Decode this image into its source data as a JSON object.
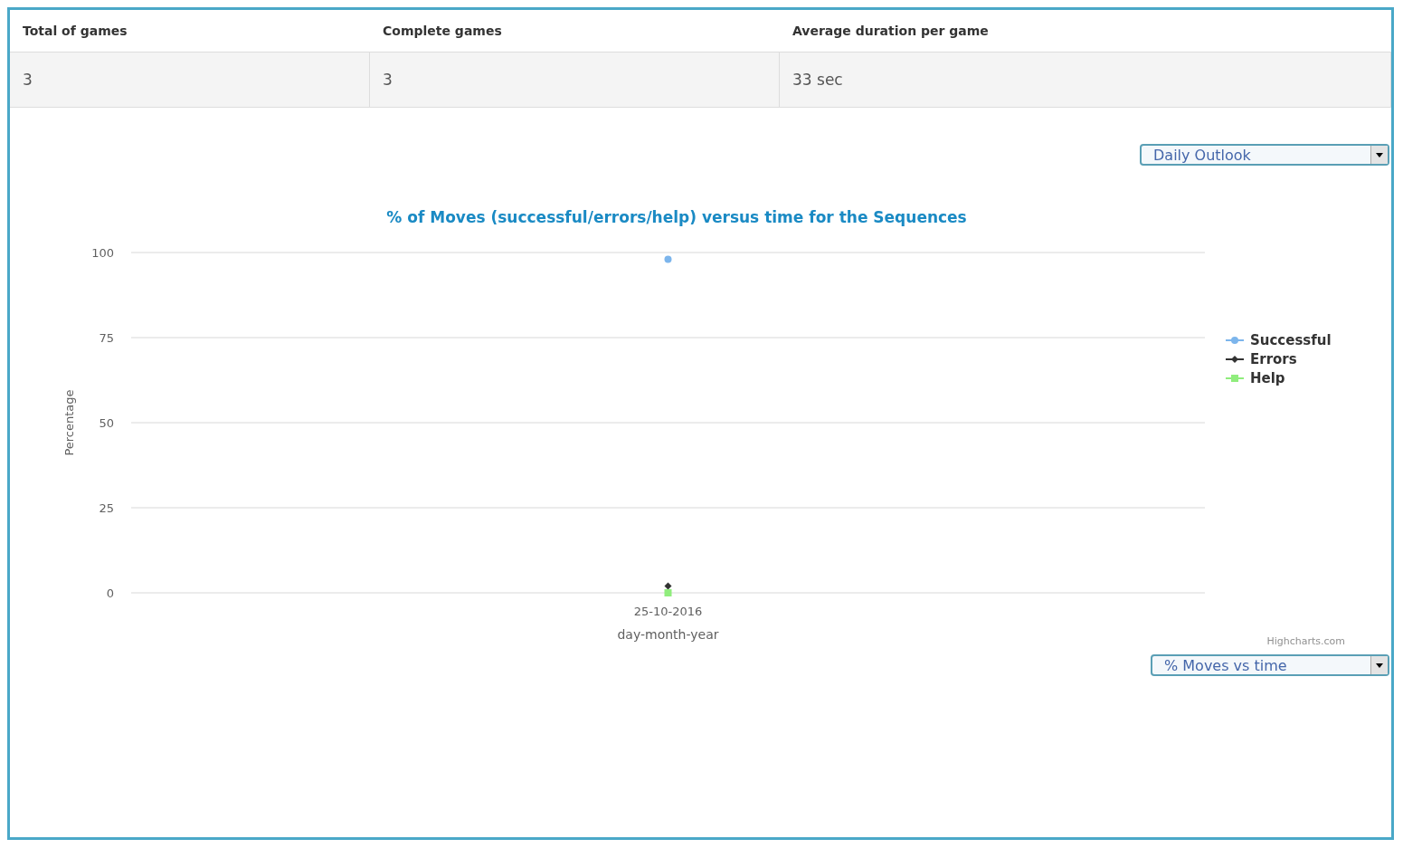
{
  "summary_table": {
    "columns": [
      "Total of games",
      "Complete games",
      "Average duration per game"
    ],
    "rows": [
      [
        "3",
        "3",
        "33 sec"
      ]
    ]
  },
  "period_select": {
    "value": "Daily Outlook"
  },
  "chart": {
    "chart_data": {
      "type": "scatter",
      "title": "% of Moves (successful/errors/help) versus time for the Sequences",
      "xlabel": "day-month-year",
      "ylabel": "Percentage",
      "categories": [
        "25-10-2016"
      ],
      "ylim": [
        0,
        100
      ],
      "grid": true,
      "legend": true,
      "yticks": [
        0,
        25,
        50,
        75,
        100
      ],
      "series": [
        {
          "name": "Successful",
          "color": "#7cb5ec",
          "marker": "circle",
          "values": [
            98
          ]
        },
        {
          "name": "Errors",
          "color": "#333333",
          "marker": "diamond",
          "values": [
            2
          ]
        },
        {
          "name": "Help",
          "color": "#90ed7d",
          "marker": "square",
          "values": [
            0
          ]
        }
      ]
    },
    "credits": "Highcharts.com"
  },
  "chart_select": {
    "value": "% Moves vs time"
  }
}
